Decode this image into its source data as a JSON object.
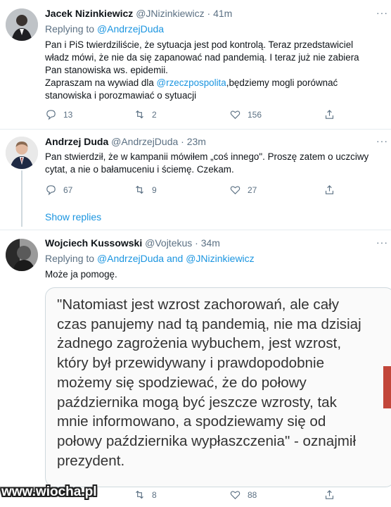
{
  "tweets": [
    {
      "name": "Jacek Nizinkiewicz",
      "handle": "@JNizinkiewicz",
      "time": "41m",
      "reply_prefix": "Replying to",
      "reply_to": "@AndrzejDuda",
      "lines": [
        "Pan i PiS twierdziliście, że sytuacja jest pod kontrolą. Teraz przedstawiciel",
        "władz mówi, że nie da się zapanować nad pandemią. I teraz już nie zabiera",
        "Pan stanowiska ws. epidemii."
      ],
      "line4_prefix": "Zapraszam na wywiad dla ",
      "line4_mention": "@rzeczpospolita",
      "line4_suffix": ",będziemy mogli porównać",
      "line5": "stanowiska i porozmawiać o sytuacji",
      "replies": "13",
      "retweets": "2",
      "likes": "156"
    },
    {
      "name": "Andrzej Duda",
      "handle": "@AndrzejDuda",
      "time": "23m",
      "lines": [
        "Pan stwierdził, że w kampanii mówiłem „coś innego\". Proszę zatem o uczciwy",
        "cytat, a nie o bałamuceniu i ściemę. Czekam."
      ],
      "replies": "67",
      "retweets": "9",
      "likes": "27"
    },
    {
      "name": "Wojciech Kussowski",
      "handle": "@Vojtekus",
      "time": "34m",
      "reply_prefix": "Replying to",
      "reply_to": "@AndrzejDuda and @JNizinkiewicz",
      "text": "Może ja pomogę.",
      "quote_lines": [
        "\"Natomiast jest wzrost zachorowań, ale cały",
        "czas panujemy nad tą pandemią, nie ma dzisiaj",
        "żadnego zagrożenia wybuchem, jest wzrost,",
        "który był przewidywany i prawdopodobnie",
        "możemy się spodziewać, że do połowy",
        "października mogą być jeszcze wzrosty, tak",
        "mnie informowano, a spodziewamy się od",
        "połowy października wypłaszczenia\" - oznajmił",
        "prezydent."
      ],
      "retweets": "8",
      "likes": "88"
    }
  ],
  "show_replies": "Show replies",
  "separator_dot": "·",
  "watermark": "www.wiocha.pl",
  "icons": [
    "reply-icon",
    "retweet-icon",
    "like-icon",
    "share-icon",
    "more-icon"
  ],
  "colors": {
    "link": "#1b95e0",
    "muted": "#5b7083",
    "text": "#0f1419",
    "border": "#cfd9de"
  }
}
